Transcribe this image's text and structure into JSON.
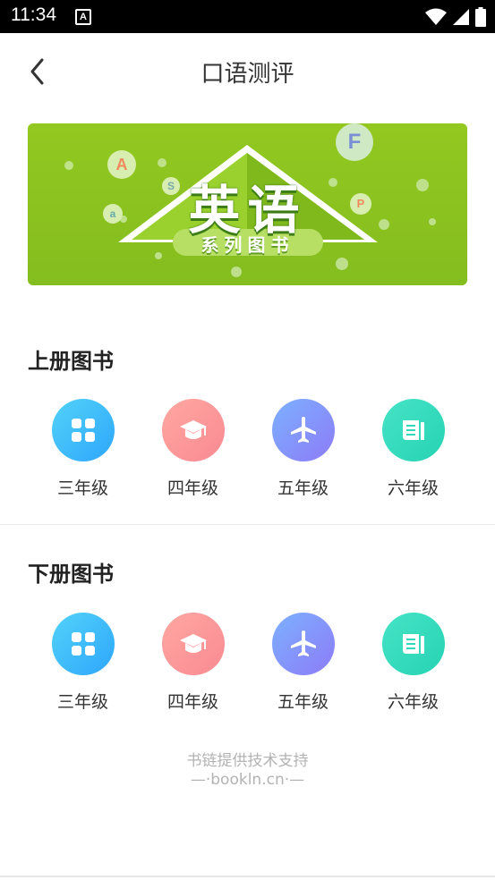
{
  "status_bar": {
    "time": "11:34",
    "notif_letter": "A"
  },
  "header": {
    "title": "口语测评"
  },
  "banner": {
    "title": "英语",
    "subtitle": "系列图书",
    "letters": [
      "A",
      "S",
      "a",
      "F",
      "P"
    ]
  },
  "sections": [
    {
      "title": "上册图书",
      "items": [
        {
          "label": "三年级",
          "icon": "grid-apps-icon"
        },
        {
          "label": "四年级",
          "icon": "graduation-cap-icon"
        },
        {
          "label": "五年级",
          "icon": "airplane-icon"
        },
        {
          "label": "六年级",
          "icon": "book-document-icon"
        }
      ]
    },
    {
      "title": "下册图书",
      "items": [
        {
          "label": "三年级",
          "icon": "grid-apps-icon"
        },
        {
          "label": "四年级",
          "icon": "graduation-cap-icon"
        },
        {
          "label": "五年级",
          "icon": "airplane-icon"
        },
        {
          "label": "六年级",
          "icon": "book-document-icon"
        }
      ]
    }
  ],
  "footer": {
    "line1": "书链提供技术支持",
    "line2": "—·bookln.cn·—"
  },
  "colors": {
    "grade3": "#34aefb",
    "grade4": "#fb929a",
    "grade5": "#8b8bf9",
    "grade6": "#2edab9",
    "banner": "#8cc320"
  }
}
